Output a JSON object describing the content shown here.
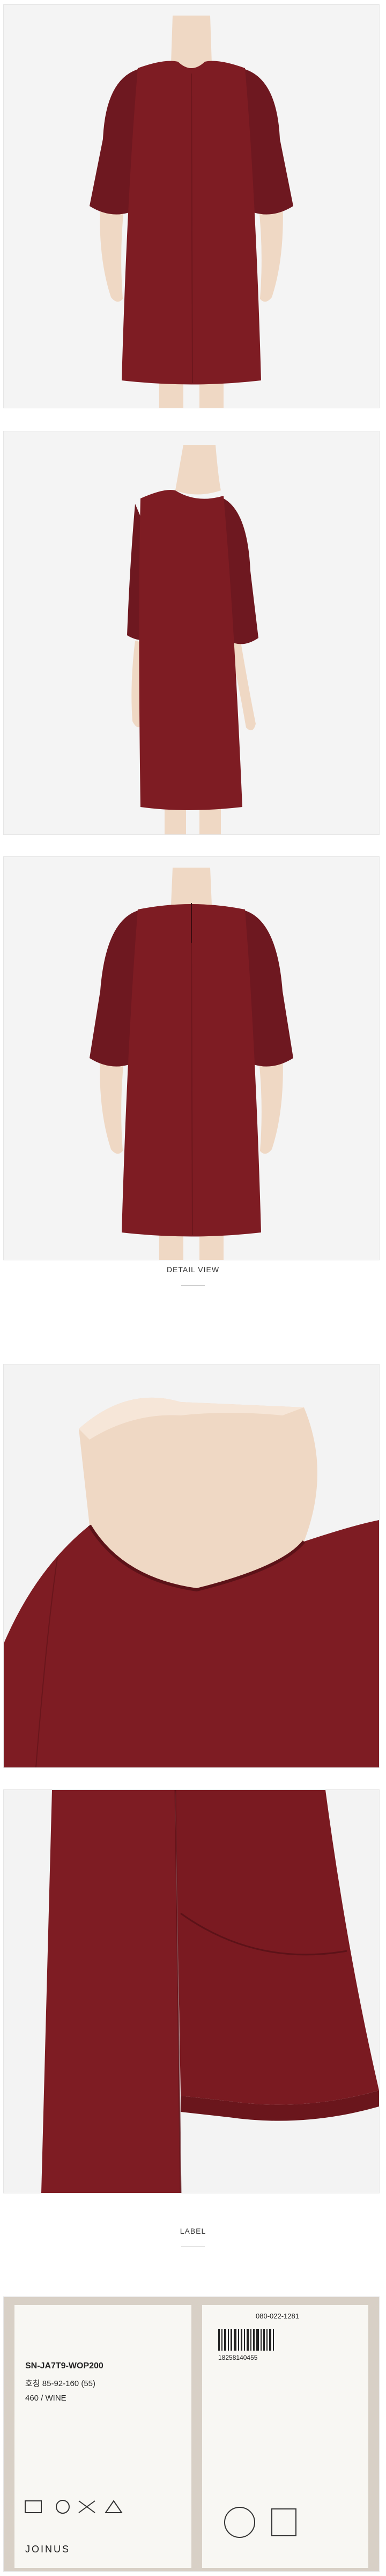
{
  "colors": {
    "dress": "#7e1c23",
    "dress_dark": "#5c1218",
    "skin": "#efd8c4",
    "panel_bg": "#f4f4f4"
  },
  "sections": {
    "detail_caption": "DETAIL VIEW",
    "label_caption": "LABEL"
  },
  "label": {
    "product_code": "SN-JA7T9-WOP200",
    "size": "호칭 85-92-160 (55)",
    "color": "460 / WINE",
    "brand": "JOINUS",
    "phone": "080-022-1281",
    "barcode_number": "18258140455"
  }
}
